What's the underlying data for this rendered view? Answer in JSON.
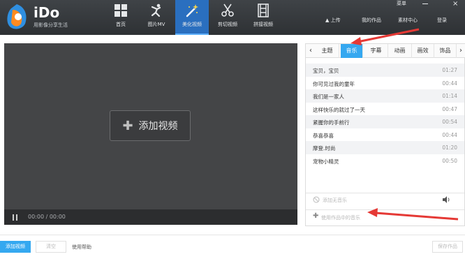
{
  "app": {
    "brand": "iDo",
    "slogan": "用影像分享生活"
  },
  "window": {
    "menu_label": "菜单"
  },
  "nav": [
    {
      "label": "首页",
      "icon": "home-grid-icon"
    },
    {
      "label": "图片MV",
      "icon": "dancer-icon"
    },
    {
      "label": "美化视频",
      "icon": "magic-wand-icon",
      "active": true
    },
    {
      "label": "剪切视频",
      "icon": "scissors-icon"
    },
    {
      "label": "拼接视频",
      "icon": "film-strip-icon"
    }
  ],
  "top_links": {
    "upload": "上传",
    "my_works": "我的作品",
    "materials": "素材中心",
    "login": "登录"
  },
  "video": {
    "add_label": "添加视频",
    "timecode": "00:00 / 00:00"
  },
  "panel": {
    "tabs": [
      "主题",
      "音乐",
      "字幕",
      "动画",
      "画效",
      "饰品"
    ],
    "active_tab": "音乐",
    "music": [
      {
        "title": "宝贝，宝贝",
        "duration": "01:27"
      },
      {
        "title": "你可见过我的童年",
        "duration": "00:44"
      },
      {
        "title": "我们是一家人",
        "duration": "01:14"
      },
      {
        "title": "这样快乐的就过了一天",
        "duration": "00:47"
      },
      {
        "title": "紧握你的手前行",
        "duration": "00:54"
      },
      {
        "title": "恭喜恭喜",
        "duration": "00:44"
      },
      {
        "title": "摩登.时尚",
        "duration": "01:20"
      },
      {
        "title": "宠物小精灵",
        "duration": "00:50"
      }
    ],
    "no_sound_label": "添加无音乐",
    "use_work_music_label": "使用作品中的音乐"
  },
  "bottom": {
    "add_video": "添加视频",
    "clear": "清空",
    "tips": "使用帮助",
    "save": "保存作品"
  },
  "colors": {
    "accent": "#35a8f0",
    "annotation": "#e53935",
    "topbar": "#35383b"
  }
}
